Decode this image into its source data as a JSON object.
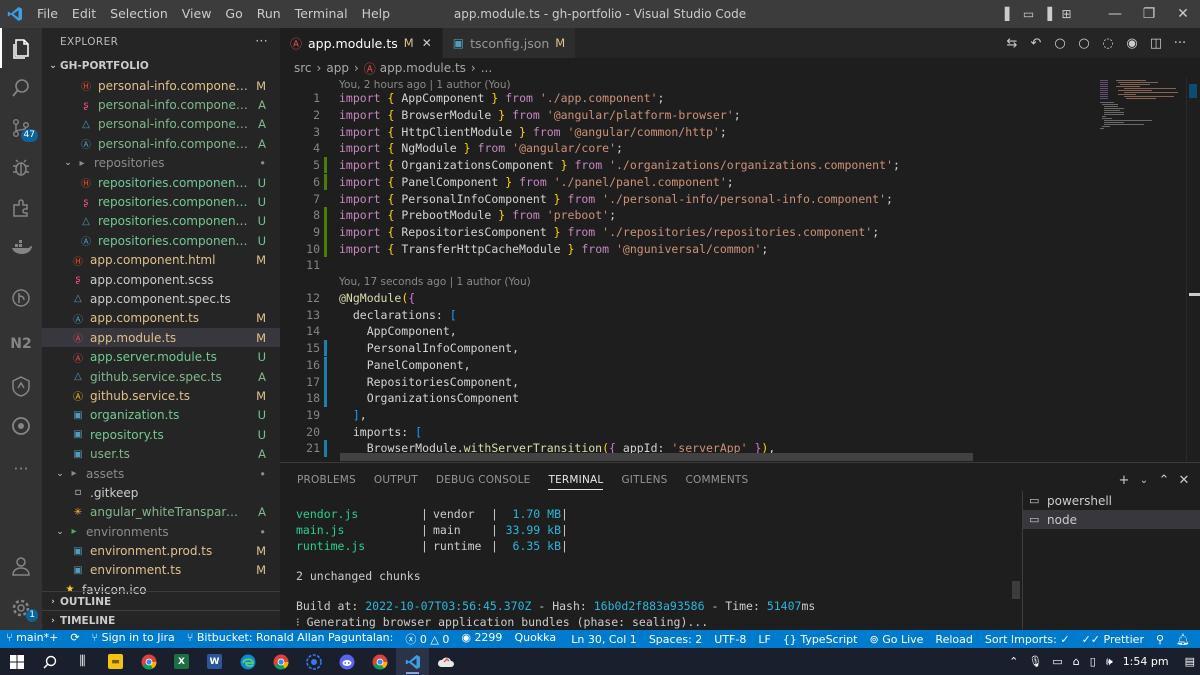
{
  "window": {
    "title": "app.module.ts - gh-portfolio - Visual Studio Code",
    "menu": [
      "File",
      "Edit",
      "Selection",
      "View",
      "Go",
      "Run",
      "Terminal",
      "Help"
    ]
  },
  "activity_bar": {
    "items": [
      "explorer-icon",
      "search-icon",
      "source-control-icon",
      "run-debug-icon",
      "extensions-icon",
      "docker-icon",
      "gitlens-icon",
      "nx-icon",
      "remote-icon",
      "gitlens-inspect-icon",
      "more-icon",
      "accounts-icon",
      "manage-icon"
    ],
    "scm_badge": "47",
    "manage_badge": "1",
    "nx_label": "N2"
  },
  "sidebar": {
    "title": "EXPLORER",
    "more": "···",
    "root": "GH-PORTFOLIO",
    "tree": [
      {
        "name": "personal-info.component....",
        "status": "M",
        "kind": "html",
        "depth": 2,
        "sc": "mod"
      },
      {
        "name": "personal-info.component....",
        "status": "A",
        "kind": "scss",
        "depth": 2,
        "sc": "add"
      },
      {
        "name": "personal-info.component....",
        "status": "A",
        "kind": "spec",
        "depth": 2,
        "sc": "add"
      },
      {
        "name": "personal-info.component.ts",
        "status": "A",
        "kind": "ts",
        "depth": 2,
        "sc": "add"
      },
      {
        "name": "repositories",
        "status": "•",
        "kind": "folder",
        "depth": 1,
        "sc": "dim"
      },
      {
        "name": "repositories.component.ht...",
        "status": "U",
        "kind": "html",
        "depth": 2,
        "sc": "unt"
      },
      {
        "name": "repositories.component.sc...",
        "status": "U",
        "kind": "scss",
        "depth": 2,
        "sc": "unt"
      },
      {
        "name": "repositories.component.s...",
        "status": "U",
        "kind": "spec",
        "depth": 2,
        "sc": "unt"
      },
      {
        "name": "repositories.component.ts",
        "status": "U",
        "kind": "ts",
        "depth": 2,
        "sc": "unt"
      },
      {
        "name": "app.component.html",
        "status": "M",
        "kind": "html",
        "depth": 1,
        "sc": "mod"
      },
      {
        "name": "app.component.scss",
        "status": "",
        "kind": "scss",
        "depth": 1,
        "sc": "none"
      },
      {
        "name": "app.component.spec.ts",
        "status": "",
        "kind": "spec",
        "depth": 1,
        "sc": "none"
      },
      {
        "name": "app.component.ts",
        "status": "M",
        "kind": "ts",
        "depth": 1,
        "sc": "mod"
      },
      {
        "name": "app.module.ts",
        "status": "M",
        "kind": "module",
        "depth": 1,
        "sc": "mod"
      },
      {
        "name": "app.server.module.ts",
        "status": "U",
        "kind": "module",
        "depth": 1,
        "sc": "unt"
      },
      {
        "name": "github.service.spec.ts",
        "status": "A",
        "kind": "spec",
        "depth": 1,
        "sc": "add"
      },
      {
        "name": "github.service.ts",
        "status": "M",
        "kind": "service",
        "depth": 1,
        "sc": "mod"
      },
      {
        "name": "organization.ts",
        "status": "U",
        "kind": "tsfile",
        "depth": 1,
        "sc": "unt"
      },
      {
        "name": "repository.ts",
        "status": "U",
        "kind": "tsfile",
        "depth": 1,
        "sc": "unt"
      },
      {
        "name": "user.ts",
        "status": "A",
        "kind": "tsfile",
        "depth": 1,
        "sc": "add"
      },
      {
        "name": "assets",
        "status": "•",
        "kind": "folder",
        "depth": 0,
        "sc": "dim"
      },
      {
        "name": ".gitkeep",
        "status": "",
        "kind": "plain",
        "depth": 1,
        "sc": "none"
      },
      {
        "name": "angular_whiteTransparent.svg",
        "status": "A",
        "kind": "svg",
        "depth": 1,
        "sc": "add"
      },
      {
        "name": "environments",
        "status": "•",
        "kind": "folder-env",
        "depth": 0,
        "sc": "dim"
      },
      {
        "name": "environment.prod.ts",
        "status": "M",
        "kind": "tsfile",
        "depth": 1,
        "sc": "mod"
      },
      {
        "name": "environment.ts",
        "status": "M",
        "kind": "tsfile",
        "depth": 1,
        "sc": "mod"
      },
      {
        "name": "favicon.ico",
        "status": "",
        "kind": "star",
        "depth": 0,
        "sc": "none"
      }
    ],
    "outline": "OUTLINE",
    "timeline": "TIMELINE"
  },
  "tabs": [
    {
      "label": "app.module.ts",
      "modified": "M",
      "active": true
    },
    {
      "label": "tsconfig.json",
      "modified": "M",
      "active": false
    }
  ],
  "breadcrumb": [
    "src",
    "app",
    "app.module.ts",
    "..."
  ],
  "blame": [
    "You, 2 hours ago | 1 author (You)",
    "You, 17 seconds ago | 1 author (You)"
  ],
  "code_lines": [
    {
      "n": "1",
      "g": "",
      "tokens": [
        [
          "kw",
          "import"
        ],
        [
          "cls",
          " "
        ],
        [
          "br",
          "{"
        ],
        [
          "cls",
          " AppComponent "
        ],
        [
          "br",
          "}"
        ],
        [
          "kw",
          " from "
        ],
        [
          "str",
          "'./app.component'"
        ],
        [
          "cls",
          ";"
        ]
      ]
    },
    {
      "n": "2",
      "g": "",
      "tokens": [
        [
          "kw",
          "import"
        ],
        [
          "cls",
          " "
        ],
        [
          "br",
          "{"
        ],
        [
          "cls",
          " BrowserModule "
        ],
        [
          "br",
          "}"
        ],
        [
          "kw",
          " from "
        ],
        [
          "str",
          "'@angular/platform-browser'"
        ],
        [
          "cls",
          ";"
        ]
      ]
    },
    {
      "n": "3",
      "g": "",
      "tokens": [
        [
          "kw",
          "import"
        ],
        [
          "cls",
          " "
        ],
        [
          "br",
          "{"
        ],
        [
          "cls",
          " HttpClientModule "
        ],
        [
          "br",
          "}"
        ],
        [
          "kw",
          " from "
        ],
        [
          "str",
          "'@angular/common/http'"
        ],
        [
          "cls",
          ";"
        ]
      ]
    },
    {
      "n": "4",
      "g": "",
      "tokens": [
        [
          "kw",
          "import"
        ],
        [
          "cls",
          " "
        ],
        [
          "br",
          "{"
        ],
        [
          "cls",
          " NgModule "
        ],
        [
          "br",
          "}"
        ],
        [
          "kw",
          " from "
        ],
        [
          "str",
          "'@angular/core'"
        ],
        [
          "cls",
          ";"
        ]
      ]
    },
    {
      "n": "5",
      "g": "add",
      "tokens": [
        [
          "kw",
          "import"
        ],
        [
          "cls",
          " "
        ],
        [
          "br",
          "{"
        ],
        [
          "cls",
          " OrganizationsComponent "
        ],
        [
          "br",
          "}"
        ],
        [
          "kw",
          " from "
        ],
        [
          "str",
          "'./organizations/organizations.component'"
        ],
        [
          "cls",
          ";"
        ]
      ]
    },
    {
      "n": "6",
      "g": "add",
      "tokens": [
        [
          "kw",
          "import"
        ],
        [
          "cls",
          " "
        ],
        [
          "br",
          "{"
        ],
        [
          "cls",
          " PanelComponent "
        ],
        [
          "br",
          "}"
        ],
        [
          "kw",
          " from "
        ],
        [
          "str",
          "'./panel/panel.component'"
        ],
        [
          "cls",
          ";"
        ]
      ]
    },
    {
      "n": "7",
      "g": "",
      "tokens": [
        [
          "kw",
          "import"
        ],
        [
          "cls",
          " "
        ],
        [
          "br",
          "{"
        ],
        [
          "cls",
          " PersonalInfoComponent "
        ],
        [
          "br",
          "}"
        ],
        [
          "kw",
          " from "
        ],
        [
          "str",
          "'./personal-info/personal-info.component'"
        ],
        [
          "cls",
          ";"
        ]
      ]
    },
    {
      "n": "8",
      "g": "add",
      "tokens": [
        [
          "kw",
          "import"
        ],
        [
          "cls",
          " "
        ],
        [
          "br",
          "{"
        ],
        [
          "cls",
          " PrebootModule "
        ],
        [
          "br",
          "}"
        ],
        [
          "kw",
          " from "
        ],
        [
          "str",
          "'preboot'"
        ],
        [
          "cls",
          ";"
        ]
      ]
    },
    {
      "n": "9",
      "g": "add",
      "tokens": [
        [
          "kw",
          "import"
        ],
        [
          "cls",
          " "
        ],
        [
          "br",
          "{"
        ],
        [
          "cls",
          " RepositoriesComponent "
        ],
        [
          "br",
          "}"
        ],
        [
          "kw",
          " from "
        ],
        [
          "str",
          "'./repositories/repositories.component'"
        ],
        [
          "cls",
          ";"
        ]
      ]
    },
    {
      "n": "10",
      "g": "add",
      "tokens": [
        [
          "kw",
          "import"
        ],
        [
          "cls",
          " "
        ],
        [
          "br",
          "{"
        ],
        [
          "cls",
          " TransferHttpCacheModule "
        ],
        [
          "br",
          "}"
        ],
        [
          "kw",
          " from "
        ],
        [
          "str",
          "'@nguniversal/common'"
        ],
        [
          "cls",
          ";"
        ]
      ]
    },
    {
      "n": "11",
      "g": "",
      "tokens": []
    },
    {
      "n": "12",
      "g": "",
      "tokens": [
        [
          "fn",
          "@NgModule"
        ],
        [
          "br",
          "("
        ],
        [
          "br2",
          "{"
        ]
      ]
    },
    {
      "n": "13",
      "g": "",
      "tokens": [
        [
          "cls",
          "  declarations: "
        ],
        [
          "br3",
          "["
        ]
      ]
    },
    {
      "n": "14",
      "g": "",
      "tokens": [
        [
          "cls",
          "    AppComponent,"
        ]
      ]
    },
    {
      "n": "15",
      "g": "mod",
      "tokens": [
        [
          "cls",
          "    PersonalInfoComponent,"
        ]
      ]
    },
    {
      "n": "16",
      "g": "mod",
      "tokens": [
        [
          "cls",
          "    PanelComponent,"
        ]
      ]
    },
    {
      "n": "17",
      "g": "mod",
      "tokens": [
        [
          "cls",
          "    RepositoriesComponent,"
        ]
      ]
    },
    {
      "n": "18",
      "g": "mod",
      "tokens": [
        [
          "cls",
          "    OrganizationsComponent"
        ]
      ]
    },
    {
      "n": "19",
      "g": "",
      "tokens": [
        [
          "cls",
          "  "
        ],
        [
          "br3",
          "]"
        ],
        [
          "cls",
          ","
        ]
      ]
    },
    {
      "n": "20",
      "g": "",
      "tokens": [
        [
          "cls",
          "  imports: "
        ],
        [
          "br3",
          "["
        ]
      ]
    },
    {
      "n": "21",
      "g": "mod",
      "tokens": [
        [
          "cls",
          "    BrowserModule."
        ],
        [
          "fn",
          "withServerTransition"
        ],
        [
          "br",
          "("
        ],
        [
          "br2",
          "{"
        ],
        [
          "cls",
          " appId: "
        ],
        [
          "str",
          "'serverApp'"
        ],
        [
          "cls",
          " "
        ],
        [
          "br2",
          "}"
        ],
        [
          "br",
          ")"
        ],
        [
          "cls",
          ","
        ]
      ]
    }
  ],
  "panel": {
    "tabs": [
      "PROBLEMS",
      "OUTPUT",
      "DEBUG CONSOLE",
      "TERMINAL",
      "GITLENS",
      "COMMENTS"
    ],
    "active_tab": "TERMINAL",
    "actions": [
      "+",
      "⌄",
      "⌃",
      "✕"
    ],
    "terminals": [
      "powershell",
      "node"
    ],
    "bundles": [
      {
        "file": "vendor.js",
        "name": "vendor",
        "size": "1.70 MB"
      },
      {
        "file": "main.js",
        "name": "main",
        "size": "33.99 kB"
      },
      {
        "file": "runtime.js",
        "name": "runtime",
        "size": "6.35 kB"
      }
    ],
    "unchanged": "2 unchanged chunks",
    "build_prefix": "Build at: ",
    "build_date": "2022-10-07T03:56:45.370Z",
    "hash_prefix": " - Hash: ",
    "hash": "16b0d2f883a93586",
    "time_prefix": " - Time: ",
    "time": "51407",
    "time_unit": "ms",
    "generating": "⁝ Generating browser application bundles (phase: sealing)..."
  },
  "statusbar": {
    "branch": "main*+",
    "sync": "⟳",
    "jira": "Sign in to Jira",
    "bitbucket": "Bitbucket: Ronald Allan Paguntalan:",
    "errors": "0",
    "warnings": "0",
    "live_count": "2299",
    "quokka": "Quokka",
    "position": "Ln 30, Col 1",
    "spaces": "Spaces: 2",
    "encoding": "UTF-8",
    "eol": "LF",
    "language": "TypeScript",
    "golive": "Go Live",
    "reload": "Reload",
    "sort_imports": "Sort Imports: ✓",
    "prettier": "Prettier"
  },
  "taskbar": {
    "time": "1:54 pm",
    "apps": [
      "start-icon",
      "search-icon",
      "task-view-icon",
      "file-explorer-icon",
      "chrome-icon",
      "excel-icon",
      "word-icon",
      "edge-icon",
      "chrome-alt-icon",
      "signal-icon",
      "discord-icon",
      "chrome-profile-icon",
      "vscode-icon",
      "cloud-icon"
    ]
  },
  "colors": {
    "statusbar": "#007acc",
    "activity": "#333333",
    "sidebar": "#252526",
    "editor": "#1e1e1e"
  }
}
